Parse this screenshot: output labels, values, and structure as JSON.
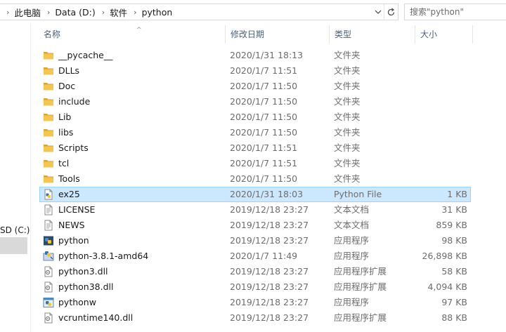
{
  "address_bar": {
    "breadcrumbs": [
      "此电脑",
      "Data (D:)",
      "软件",
      "python"
    ],
    "separator": "›"
  },
  "search": {
    "placeholder": "搜索\"python\""
  },
  "nav_pane": {
    "visible_item": "SD (C:)"
  },
  "columns": {
    "name": "名称",
    "date": "修改日期",
    "type": "类型",
    "size": "大小"
  },
  "files": [
    {
      "name": "__pycache__",
      "date": "2020/1/31 18:13",
      "type": "文件夹",
      "size": "",
      "icon": "folder-icon",
      "selected": false
    },
    {
      "name": "DLLs",
      "date": "2020/1/7 11:51",
      "type": "文件夹",
      "size": "",
      "icon": "folder-icon",
      "selected": false
    },
    {
      "name": "Doc",
      "date": "2020/1/7 11:50",
      "type": "文件夹",
      "size": "",
      "icon": "folder-icon",
      "selected": false
    },
    {
      "name": "include",
      "date": "2020/1/7 11:50",
      "type": "文件夹",
      "size": "",
      "icon": "folder-icon",
      "selected": false
    },
    {
      "name": "Lib",
      "date": "2020/1/7 11:50",
      "type": "文件夹",
      "size": "",
      "icon": "folder-icon",
      "selected": false
    },
    {
      "name": "libs",
      "date": "2020/1/7 11:50",
      "type": "文件夹",
      "size": "",
      "icon": "folder-icon",
      "selected": false
    },
    {
      "name": "Scripts",
      "date": "2020/1/7 11:51",
      "type": "文件夹",
      "size": "",
      "icon": "folder-icon",
      "selected": false
    },
    {
      "name": "tcl",
      "date": "2020/1/7 11:51",
      "type": "文件夹",
      "size": "",
      "icon": "folder-icon",
      "selected": false
    },
    {
      "name": "Tools",
      "date": "2020/1/7 11:50",
      "type": "文件夹",
      "size": "",
      "icon": "folder-icon",
      "selected": false
    },
    {
      "name": "ex25",
      "date": "2020/1/31 18:03",
      "type": "Python File",
      "size": "1 KB",
      "icon": "python-file-icon",
      "selected": true
    },
    {
      "name": "LICENSE",
      "date": "2019/12/18 23:27",
      "type": "文本文档",
      "size": "31 KB",
      "icon": "text-file-icon",
      "selected": false
    },
    {
      "name": "NEWS",
      "date": "2019/12/18 23:27",
      "type": "文本文档",
      "size": "859 KB",
      "icon": "text-file-icon",
      "selected": false
    },
    {
      "name": "python",
      "date": "2019/12/18 23:27",
      "type": "应用程序",
      "size": "98 KB",
      "icon": "python-exe-icon",
      "selected": false
    },
    {
      "name": "python-3.8.1-amd64",
      "date": "2020/1/7 11:49",
      "type": "应用程序",
      "size": "26,898 KB",
      "icon": "installer-icon",
      "selected": false
    },
    {
      "name": "python3.dll",
      "date": "2019/12/18 23:27",
      "type": "应用程序扩展",
      "size": "58 KB",
      "icon": "dll-icon",
      "selected": false
    },
    {
      "name": "python38.dll",
      "date": "2019/12/18 23:27",
      "type": "应用程序扩展",
      "size": "4,094 KB",
      "icon": "dll-icon",
      "selected": false
    },
    {
      "name": "pythonw",
      "date": "2019/12/18 23:27",
      "type": "应用程序",
      "size": "97 KB",
      "icon": "pythonw-exe-icon",
      "selected": false
    },
    {
      "name": "vcruntime140.dll",
      "date": "2019/12/18 23:27",
      "type": "应用程序扩展",
      "size": "88 KB",
      "icon": "dll-icon",
      "selected": false
    }
  ],
  "colors": {
    "folder": "#e8b84a",
    "selection_bg": "#cce8ff",
    "selection_border": "#99d1ff",
    "header_text": "#4c607a",
    "meta_text": "#6d6d6d"
  }
}
